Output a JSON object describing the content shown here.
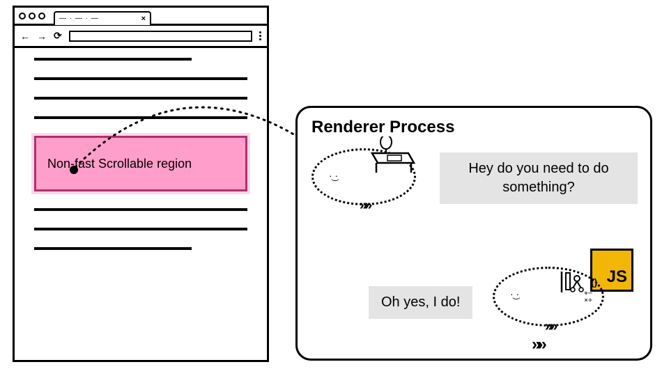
{
  "browser": {
    "tab_placeholder": "— · — · —",
    "tab_close": "×",
    "nav": {
      "back": "←",
      "forward": "→",
      "reload": "⟳"
    },
    "region_label": "Non-fast Scrollable region"
  },
  "renderer": {
    "title": "Renderer Process",
    "bubble1": "Hey do you need to do something?",
    "bubble2": "Oh yes, I do!",
    "js_label": "JS"
  },
  "characters": {
    "face": "·͜ ·",
    "chevrons": "»»"
  }
}
